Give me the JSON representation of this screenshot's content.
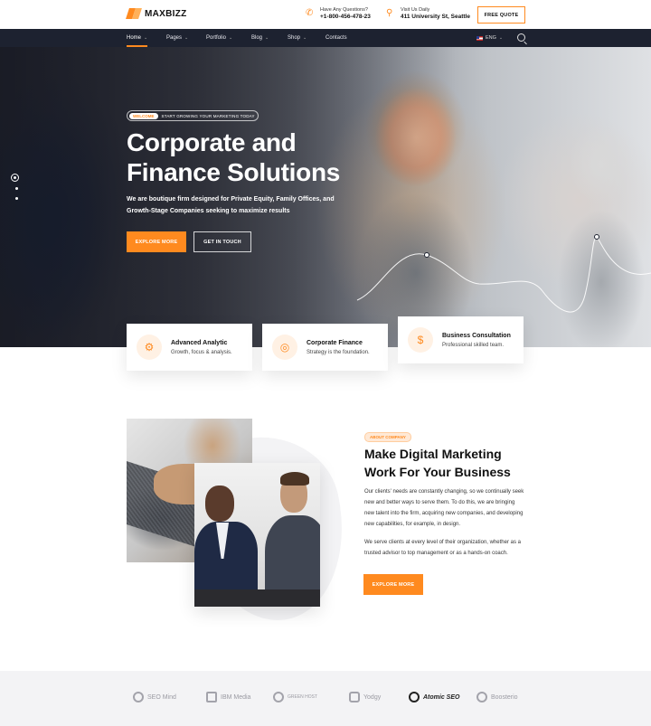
{
  "brand": {
    "name": "MAXBIZZ",
    "accent": "#ff8a1f",
    "nav_bg": "#1d2230"
  },
  "header": {
    "phone": {
      "icon": "phone-icon",
      "label": "Have Any Questions?",
      "value": "+1-800-456-478-23"
    },
    "address": {
      "icon": "location-pin-icon",
      "label": "Visit Us Daily",
      "value": "411 University St, Seattle"
    },
    "cta": "FREE QUOTE"
  },
  "nav": {
    "items": [
      {
        "label": "Home",
        "active": true,
        "dropdown": true
      },
      {
        "label": "Pages",
        "dropdown": true
      },
      {
        "label": "Portfolio",
        "dropdown": true
      },
      {
        "label": "Blog",
        "dropdown": true
      },
      {
        "label": "Shop",
        "dropdown": true
      },
      {
        "label": "Contacts",
        "dropdown": false
      }
    ],
    "language": "ENG",
    "search_icon": "search-icon"
  },
  "hero": {
    "badge_tag": "WELCOME",
    "badge_text": "START GROWING YOUR MARKETING TODAY",
    "title_line1": "Corporate and",
    "title_line2": "Finance Solutions",
    "subtitle": "We are boutique firm designed for Private Equity, Family Offices, and Growth-Stage Companies seeking to maximize results",
    "primary_btn": "EXPLORE MORE",
    "secondary_btn": "GET IN TOUCH",
    "slides": 3,
    "active_slide": 1
  },
  "features": [
    {
      "title": "Advanced Analytic",
      "subtitle": "Growth, focus & analysis.",
      "icon": "analytics-icon"
    },
    {
      "title": "Corporate Finance",
      "subtitle": "Strategy is the foundation.",
      "icon": "target-icon"
    },
    {
      "title": "Business Consultation",
      "subtitle": "Professional skilled team.",
      "icon": "money-bag-icon"
    }
  ],
  "about": {
    "tag": "ABOUT COMPANY",
    "title_line1": "Make Digital Marketing",
    "title_line2": "Work For Your Business",
    "para1": "Our clients' needs are constantly changing, so we continually seek new and better ways to serve them. To do this, we are bringing new talent into the firm, acquiring new companies, and developing new capabilities, for example, in design.",
    "para2": "We serve clients at every level of their organization, whether as a trusted advisor to top management or as a hands-on coach.",
    "button": "EXPLORE MORE"
  },
  "clients": [
    "SEO Mind",
    "IBM Media",
    "GREEN HOST",
    "Yodgy",
    "Atomic SEO",
    "Boosterio"
  ]
}
